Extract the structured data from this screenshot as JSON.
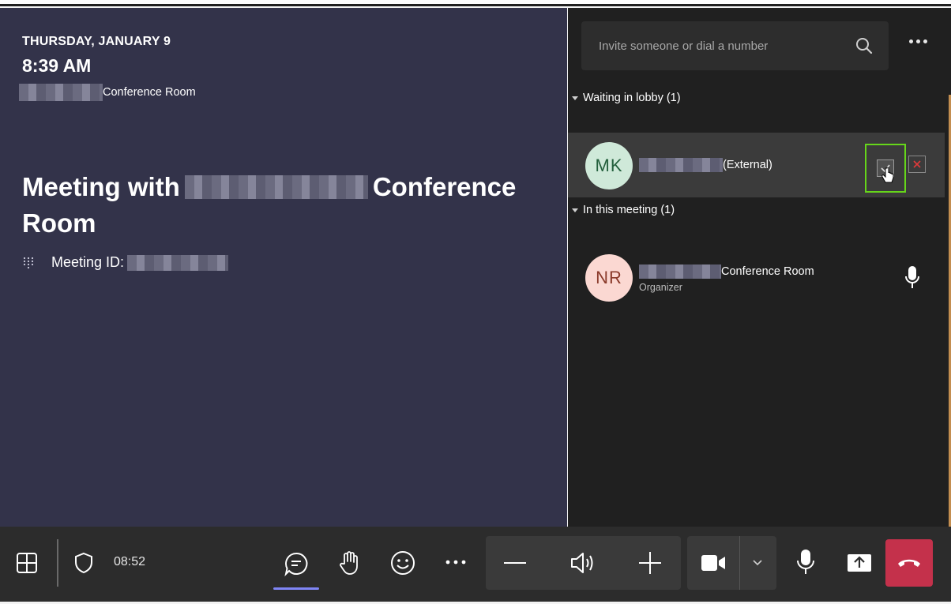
{
  "stage": {
    "date": "THURSDAY, JANUARY 9",
    "time": "8:39 AM",
    "room_suffix": "Conference Room",
    "title_prefix": "Meeting with",
    "title_suffix": "Conference Room",
    "meeting_id_label": "Meeting ID:"
  },
  "panel": {
    "search_placeholder": "Invite someone or dial a number",
    "lobby": {
      "header": "Waiting in lobby (1)",
      "person": {
        "initials": "MK",
        "tag": "(External)"
      }
    },
    "meeting": {
      "header": "In this meeting (1)",
      "person": {
        "initials": "NR",
        "name_suffix": "Conference Room",
        "role": "Organizer"
      }
    }
  },
  "toolbar": {
    "timer": "08:52"
  },
  "colors": {
    "stage_bg": "#33334a",
    "panel_bg": "#202020",
    "toolbar_bg": "#2c2c2c",
    "admit_highlight": "#66d61a",
    "hangup": "#c4314b",
    "active_indicator": "#7f85f5"
  },
  "icons": [
    "grid-icon",
    "shield-icon",
    "chat-icon",
    "raise-hand-icon",
    "emoji-icon",
    "more-icon",
    "minus-icon",
    "speaker-icon",
    "plus-icon",
    "camera-icon",
    "chevron-down-icon",
    "mic-icon",
    "share-tray-icon",
    "hang-up-icon",
    "search-icon",
    "dialpad-icon",
    "check-icon",
    "close-icon",
    "cursor-icon"
  ]
}
